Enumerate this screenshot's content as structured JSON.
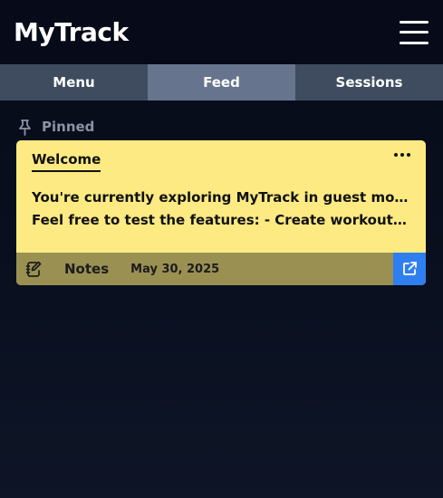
{
  "app": {
    "title": "MyTrack"
  },
  "nav": {
    "tabs": [
      {
        "label": "Menu",
        "active": false
      },
      {
        "label": "Feed",
        "active": true
      },
      {
        "label": "Sessions",
        "active": false
      }
    ]
  },
  "pinned": {
    "label": "Pinned",
    "icon": "pin-icon",
    "card": {
      "title": "Welcome",
      "body_line1": "You're currently exploring MyTrack in guest mode.",
      "body_line2": "Feel free to test the features: - Create workouts ...",
      "category": "Notes",
      "category_icon": "notes-icon",
      "date": "May 30, 2025",
      "colors": {
        "background": "#fdea82",
        "footer": "#9a9052",
        "open_button": "#2f7ff0"
      }
    }
  }
}
